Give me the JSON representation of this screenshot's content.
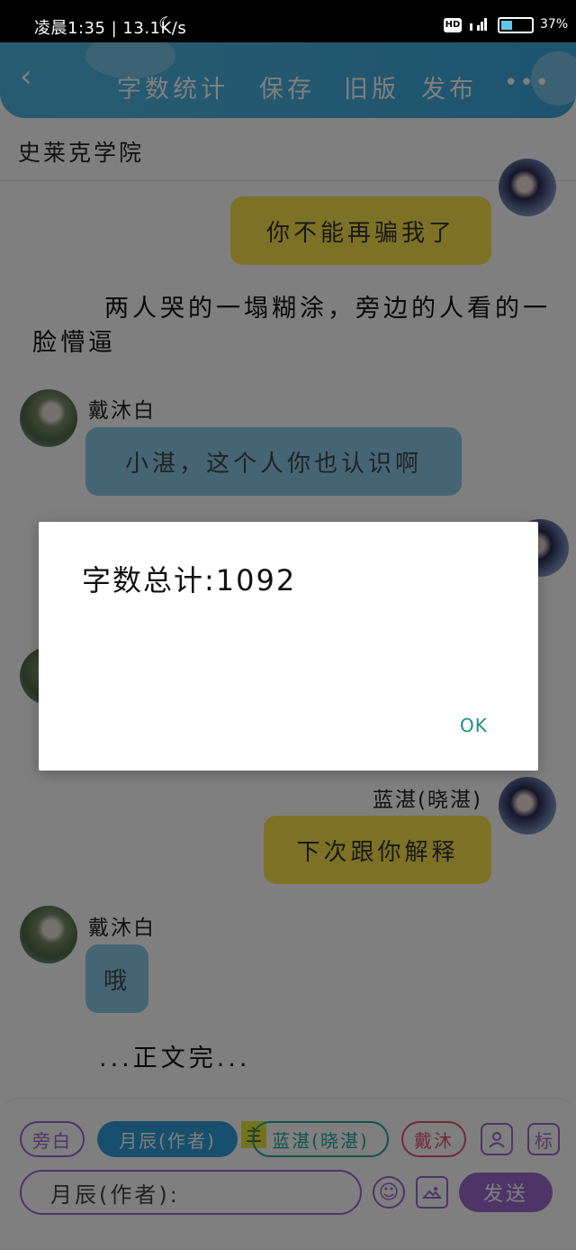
{
  "status_bar": {
    "time_text": "凌晨1:35 | 13.1K/s",
    "hd_label": "HD",
    "battery_percent_text": "37%"
  },
  "header": {
    "back_label": "‹",
    "buttons": [
      "字数统计",
      "保存",
      "旧版",
      "发布"
    ],
    "more_label": "•••"
  },
  "chat_title": "史莱克学院",
  "messages": {
    "m1_text": "你不能再骗我了",
    "narration1": "两人哭的一塌糊涂，旁边的人看的一脸懵逼",
    "m2_name": "戴沐白",
    "m2_text": "小湛，这个人你也认识啊",
    "m3_name": "蓝湛(晓湛)",
    "m3_text": "下次跟你解释",
    "m4_name": "戴沐白",
    "m4_text": "哦",
    "narration2": "...正文完..."
  },
  "dialog": {
    "message": "字数总计:1092",
    "ok_label": "OK"
  },
  "input_area": {
    "chips": [
      "旁白",
      "月辰(作者)",
      "蓝湛(晓湛)",
      "戴沐"
    ],
    "tag_label": "主",
    "mark_label": "标",
    "input_prefix": "月辰(作者):",
    "send_label": "发送"
  },
  "colors": {
    "header_blue": "#47b0e0",
    "accent_purple": "#9b6bd1",
    "bubble_yellow": "#fbe24a",
    "bubble_blue": "#8bcbea",
    "ok_teal": "#1d8f86"
  }
}
